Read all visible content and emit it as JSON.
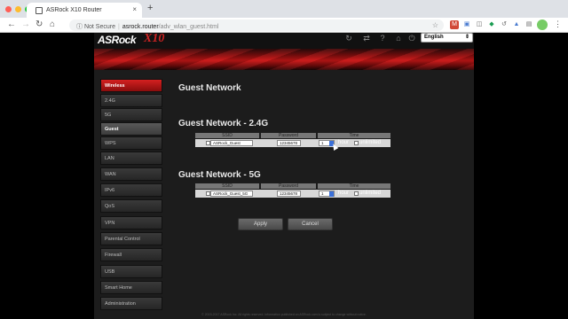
{
  "browser": {
    "tab_title": "ASRock X10 Router",
    "new_tab": "+",
    "close_tab": "×",
    "security": "Not Secure",
    "url_host": "asrock.router",
    "url_path": "/adv_wlan_guest.html"
  },
  "router": {
    "logo": "ASRock",
    "model": "X10",
    "language": "English"
  },
  "sidebar": {
    "items": [
      {
        "label": "Wireless",
        "state": "section-active"
      },
      {
        "label": "2.4G",
        "state": "normal"
      },
      {
        "label": "5G",
        "state": "normal"
      },
      {
        "label": "Guest",
        "state": "sub-active"
      },
      {
        "label": "WPS",
        "state": "normal"
      },
      {
        "label": "LAN",
        "state": "normal"
      },
      {
        "label": "WAN",
        "state": "normal"
      },
      {
        "label": "IPv6",
        "state": "normal"
      },
      {
        "label": "QoS",
        "state": "normal"
      },
      {
        "label": "VPN",
        "state": "normal"
      },
      {
        "label": "Parental Control",
        "state": "normal"
      },
      {
        "label": "Firewall",
        "state": "normal"
      },
      {
        "label": "USB",
        "state": "normal"
      },
      {
        "label": "Smart Home",
        "state": "normal"
      },
      {
        "label": "Administration",
        "state": "normal"
      }
    ]
  },
  "main": {
    "page_title": "Guest Network",
    "columns": {
      "ssid": "SSID",
      "password": "Password",
      "time": "Time"
    },
    "net24": {
      "title": "Guest Network - 2.4G",
      "ssid": "ASRock_Guest",
      "password": "12345678",
      "time": "1",
      "hour_label": "hour",
      "unlimited_label": "unlimited"
    },
    "net5": {
      "title": "Guest Network - 5G",
      "ssid": "ASRock_Guest_5G",
      "password": "12345678",
      "time": "1",
      "hour_label": "hour",
      "unlimited_label": "unlimited"
    },
    "apply": "Apply",
    "cancel": "Cancel"
  },
  "footer": "© 2015-2017 ASRock Inc. All rights reserved. Information published on ASRock.com is subject to change without notice.",
  "colors": {
    "accent": "#c41616",
    "page_bg": "#1c1c1c",
    "sidebar_item": "#2c2c2c"
  }
}
